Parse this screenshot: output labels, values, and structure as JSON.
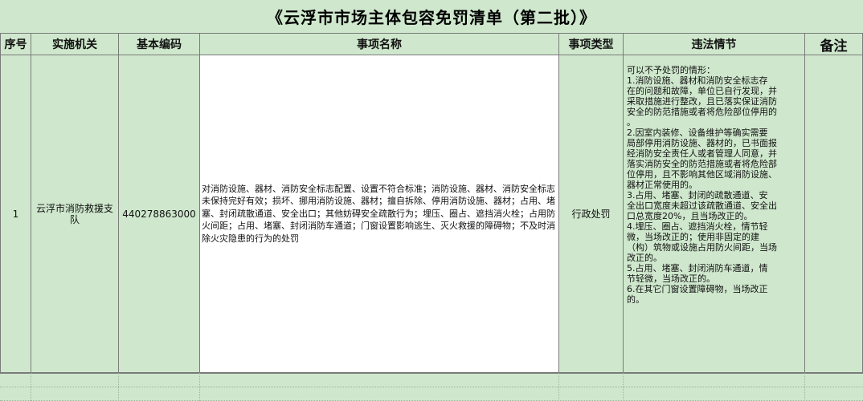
{
  "title": "《云浮市市场主体包容免罚清单（第二批）》",
  "headers": {
    "seq": "序号",
    "agency": "实施机关",
    "code": "基本编码",
    "matter": "事项名称",
    "type": "事项类型",
    "violation": "违法情节",
    "remark": "备注"
  },
  "rows": [
    {
      "seq": "1",
      "agency": "云浮市消防救援支队",
      "code": "440278863000",
      "matter": "对消防设施、器材、消防安全标志配置、设置不符合标准；消防设施、器材、消防安全标志未保持完好有效；损坏、挪用消防设施、器材；擅自拆除、停用消防设施、器材；占用、堵塞、封闭疏散通道、安全出口；其他妨碍安全疏散行为；埋压、圈占、遮挡消火栓；占用防火间距；占用、堵塞、封闭消防车通道；门窗设置影响逃生、灭火救援的障碍物；不及时消除火灾隐患的行为的处罚",
      "type": "行政处罚",
      "violation_lines": [
        "可以不予处罚的情形：",
        "1.消防设施、器材和消防安全标志存",
        "在的问题和故障，单位已自行发现，并",
        "采取措施进行整改，且已落实保证消防",
        "安全的防范措施或者将危险部位停用的",
        "。",
        "2.因室内装修、设备维护等确实需要",
        "局部停用消防设施、器材的，已书面报",
        "经消防安全责任人或者管理人同意，并",
        "落实消防安全的防范措施或者将危险部",
        "位停用，且不影响其他区域消防设施、",
        "器材正常使用的。",
        "3.占用、堵塞、封闭的疏散通道、安",
        "全出口宽度未超过该疏散通道、安全出",
        "口总宽度20%，且当场改正的。",
        "4.埋压、圈占、遮挡消火栓，情节轻",
        "微，当场改正的；使用非固定的建",
        "（构）筑物或设施占用防火间距，当场",
        "改正的。",
        "5.占用、堵塞、封闭消防车通道，情",
        "节轻微，当场改正的。",
        "6.在其它门窗设置障碍物，当场改正",
        "的。"
      ],
      "remark": ""
    }
  ],
  "colors": {
    "sheet_bg": "#cfe8cd",
    "cell_white": "#ffffff",
    "border": "#7a7a7a"
  }
}
